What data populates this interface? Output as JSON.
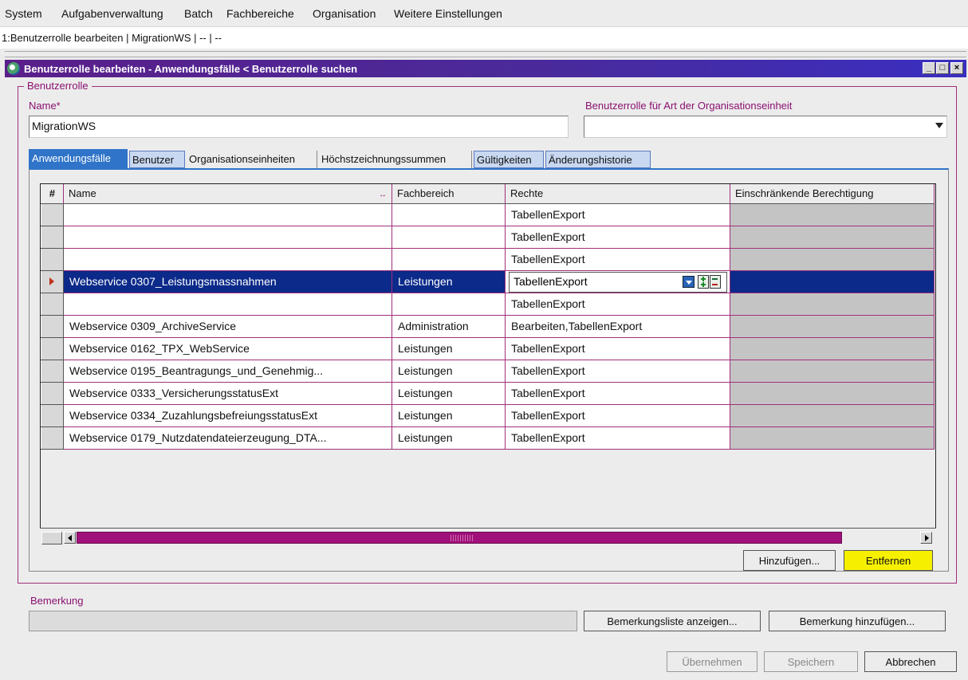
{
  "menu": {
    "items": [
      {
        "label": "System"
      },
      {
        "label": "Aufgabenverwaltung"
      },
      {
        "label": "Batch"
      },
      {
        "label": "Fachbereiche"
      },
      {
        "label": "Organisation"
      },
      {
        "label": "Weitere Einstellungen"
      }
    ]
  },
  "breadcrumb": "1:Benutzerrolle bearbeiten | MigrationWS | -- | --",
  "window": {
    "title": "Benutzerrolle bearbeiten - Anwendungsfälle < Benutzerrolle suchen",
    "minimize": "_",
    "maximize": "□",
    "close": "×"
  },
  "form": {
    "group_label": "Benutzerrolle",
    "name_label": "Name*",
    "name_value": "MigrationWS",
    "orgtype_label": "Benutzerrolle für Art der Organisationseinheit",
    "orgtype_value": ""
  },
  "tabs": [
    {
      "label": "Anwendungsfälle"
    },
    {
      "label": "Benutzer"
    },
    {
      "label": "Organisationseinheiten"
    },
    {
      "label": "Höchstzeichnungssummen"
    },
    {
      "label": "Gültigkeiten"
    },
    {
      "label": "Änderungshistorie"
    }
  ],
  "grid": {
    "columns": {
      "hash": "#",
      "name": "Name",
      "fachbereich": "Fachbereich",
      "rechte": "Rechte",
      "einschraenkung": "Einschränkende Berechtigung"
    },
    "sort_indicator": "↔",
    "rows": [
      {
        "name": "",
        "fachbereich": "",
        "rechte": "TabellenExport",
        "einschraenkung": ""
      },
      {
        "name": "",
        "fachbereich": "",
        "rechte": "TabellenExport",
        "einschraenkung": ""
      },
      {
        "name": "",
        "fachbereich": "",
        "rechte": "TabellenExport",
        "einschraenkung": ""
      },
      {
        "name": "Webservice 0307_Leistungsmassnahmen",
        "fachbereich": "Leistungen",
        "rechte": "TabellenExport",
        "einschraenkung": ""
      },
      {
        "name": "",
        "fachbereich": "",
        "rechte": "TabellenExport",
        "einschraenkung": ""
      },
      {
        "name": "Webservice 0309_ArchiveService",
        "fachbereich": "Administration",
        "rechte": "Bearbeiten,TabellenExport",
        "einschraenkung": ""
      },
      {
        "name": "Webservice 0162_TPX_WebService",
        "fachbereich": "Leistungen",
        "rechte": "TabellenExport",
        "einschraenkung": ""
      },
      {
        "name": "Webservice 0195_Beantragungs_und_Genehmig...",
        "fachbereich": "Leistungen",
        "rechte": "TabellenExport",
        "einschraenkung": ""
      },
      {
        "name": "Webservice 0333_VersicherungsstatusExt",
        "fachbereich": "Leistungen",
        "rechte": "TabellenExport",
        "einschraenkung": ""
      },
      {
        "name": "Webservice 0334_ZuzahlungsbefreiungsstatusExt",
        "fachbereich": "Leistungen",
        "rechte": "TabellenExport",
        "einschraenkung": ""
      },
      {
        "name": "Webservice 0179_Nutzdatendateierzeugung_DTA...",
        "fachbereich": "Leistungen",
        "rechte": "TabellenExport",
        "einschraenkung": ""
      }
    ]
  },
  "buttons": {
    "hinzufuegen": "Hinzufügen...",
    "entfernen": "Entfernen",
    "bemerkungsliste": "Bemerkungsliste anzeigen...",
    "bemerkung_hinzufuegen": "Bemerkung hinzufügen...",
    "uebernehmen": "Übernehmen",
    "speichern": "Speichern",
    "abbrechen": "Abbrechen"
  },
  "bemerkung": {
    "label": "Bemerkung",
    "value": ""
  },
  "colors": {
    "title_gradient_start": "#5a1f8a",
    "selection": "#0b2a8a",
    "active_tab": "#2f74c8",
    "accent_magenta": "#a0307a",
    "highlight_button": "#f6f000"
  }
}
